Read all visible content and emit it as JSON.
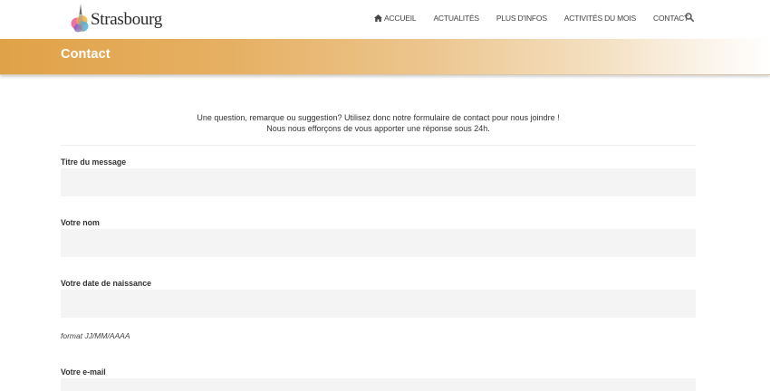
{
  "header": {
    "logo_text": "Strasbourg",
    "nav": [
      {
        "label": "ACCUEIL"
      },
      {
        "label": "ACTUALITÉS"
      },
      {
        "label": "PLUS D'INFOS"
      },
      {
        "label": "ACTIVITÉS DU MOIS"
      },
      {
        "label": "CONTACT"
      }
    ],
    "search_icon": "search-icon",
    "home_icon": "home-icon"
  },
  "banner": {
    "title": "Contact"
  },
  "intro": {
    "line1": "Une question, remarque ou suggestion? Utilisez donc notre formulaire de contact pour nous joindre !",
    "line2": "Nous nous efforçons de vous apporter une réponse sous 24h."
  },
  "form": {
    "fields": [
      {
        "label": "Titre du message",
        "value": ""
      },
      {
        "label": "Votre nom",
        "value": ""
      },
      {
        "label": "Votre date de naissance",
        "value": "",
        "hint": "format JJ/MM/AAAA"
      },
      {
        "label": "Votre e-mail",
        "value": ""
      }
    ]
  },
  "colors": {
    "banner_start": "#e0a248",
    "banner_end": "#ffffff",
    "input_bg": "#f4f4f4"
  }
}
